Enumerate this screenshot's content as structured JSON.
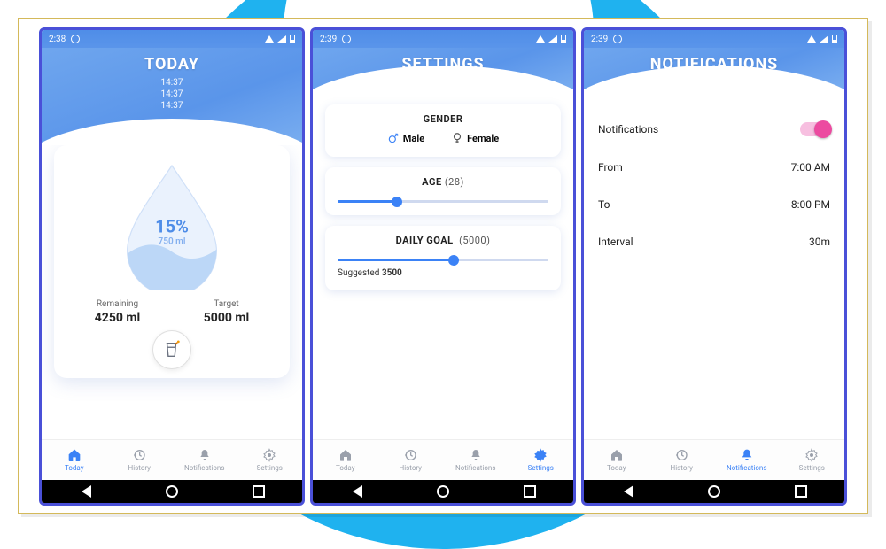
{
  "status": {
    "time1": "2:38",
    "time2": "2:39",
    "time3": "2:39"
  },
  "today": {
    "title": "TODAY",
    "times": [
      "14:37",
      "14:37",
      "14:37"
    ],
    "percent": "15%",
    "intake": "750 ml",
    "remaining_label": "Remaining",
    "remaining_value": "4250 ml",
    "target_label": "Target",
    "target_value": "5000 ml"
  },
  "settings": {
    "title": "SETTINGS",
    "gender": {
      "heading": "GENDER",
      "male": "Male",
      "female": "Female"
    },
    "age": {
      "heading": "AGE",
      "value": "(28)",
      "slider_pct": 28
    },
    "goal": {
      "heading": "DAILY GOAL",
      "value": "(5000)",
      "slider_pct": 55,
      "suggested_label": "Suggested",
      "suggested_value": "3500"
    }
  },
  "notifications": {
    "title": "NOTIFICATIONS",
    "rows": {
      "enable": "Notifications",
      "from_label": "From",
      "from_value": "7:00 AM",
      "to_label": "To",
      "to_value": "8:00 PM",
      "interval_label": "Interval",
      "interval_value": "30m"
    }
  },
  "tabs": {
    "today": "Today",
    "history": "History",
    "notifications": "Notifications",
    "settings": "Settings"
  }
}
